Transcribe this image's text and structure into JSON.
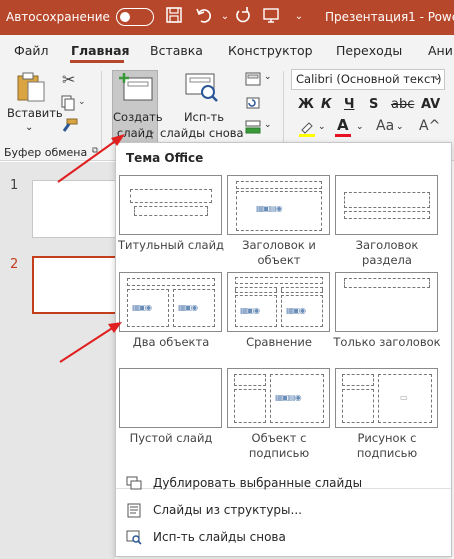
{
  "titlebar": {
    "autosave_label": "Автосохранение",
    "doc_title": "Презентация1 - Powe",
    "accent": "#b7472a"
  },
  "tabs": [
    {
      "label": "Файл"
    },
    {
      "label": "Главная"
    },
    {
      "label": "Вставка"
    },
    {
      "label": "Конструктор"
    },
    {
      "label": "Переходы"
    },
    {
      "label": "Ани"
    }
  ],
  "ribbon": {
    "paste_label": "Вставить",
    "new_slide_label_1": "Создать",
    "new_slide_label_2": "слайд",
    "reuse_label_1": "Исп-ть",
    "reuse_label_2": "слайды снова",
    "font_name": "Calibri (Основной текст)",
    "bold": "Ж",
    "italic": "К",
    "underline": "Ч",
    "strike": "S",
    "clipboard_group": "Буфер обмена",
    "font_color": "A"
  },
  "slides": [
    {
      "num": "1"
    },
    {
      "num": "2"
    }
  ],
  "gallery": {
    "heading": "Тема Office",
    "layouts": [
      {
        "label": "Титульный слайд"
      },
      {
        "label": "Заголовок и объект"
      },
      {
        "label": "Заголовок раздела"
      },
      {
        "label": "Два объекта"
      },
      {
        "label": "Сравнение"
      },
      {
        "label": "Только заголовок"
      },
      {
        "label": "Пустой слайд"
      },
      {
        "label": "Объект с подписью"
      },
      {
        "label": "Рисунок с подписью"
      }
    ],
    "menu": [
      {
        "label": "Дублировать выбранные слайды"
      },
      {
        "label": "Слайды из структуры..."
      },
      {
        "label": "Исп-ть слайды снова"
      }
    ]
  }
}
